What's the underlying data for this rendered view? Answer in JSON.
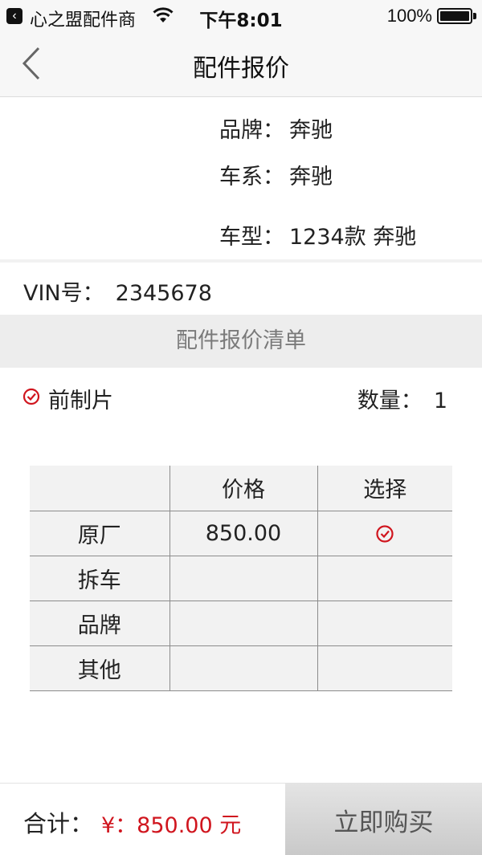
{
  "status_bar": {
    "carrier": "心之盟配件商",
    "time": "下午8:01",
    "battery": "100%"
  },
  "nav": {
    "title": "配件报价"
  },
  "vehicle": {
    "brand_label": "品牌：",
    "brand": "奔驰",
    "series_label": "车系：",
    "series": "奔驰",
    "model_label": "车型：",
    "model": "1234款 奔驰"
  },
  "vin": {
    "label": "VIN号：",
    "value": "2345678"
  },
  "section": {
    "title": "配件报价清单"
  },
  "part": {
    "name": "前制片",
    "qty_label": "数量：",
    "qty": "1",
    "checked": true
  },
  "quote_table": {
    "headers": [
      "",
      "价格",
      "选择"
    ],
    "rows": [
      {
        "type": "原厂",
        "price": "850.00",
        "selected": true
      },
      {
        "type": "拆车",
        "price": "",
        "selected": false
      },
      {
        "type": "品牌",
        "price": "",
        "selected": false
      },
      {
        "type": "其他",
        "price": "",
        "selected": false
      }
    ]
  },
  "footer": {
    "total_label": "合计：",
    "total_value": "¥：850.00 元",
    "buy_label": "立即购买"
  },
  "colors": {
    "accent_red": "#d0151e",
    "header_bg": "#f7f7f7",
    "section_bg": "#ededed"
  },
  "icons": {
    "back": "chevron-left-icon",
    "check": "check-circle-icon",
    "wifi": "wifi-icon",
    "battery": "battery-icon"
  }
}
